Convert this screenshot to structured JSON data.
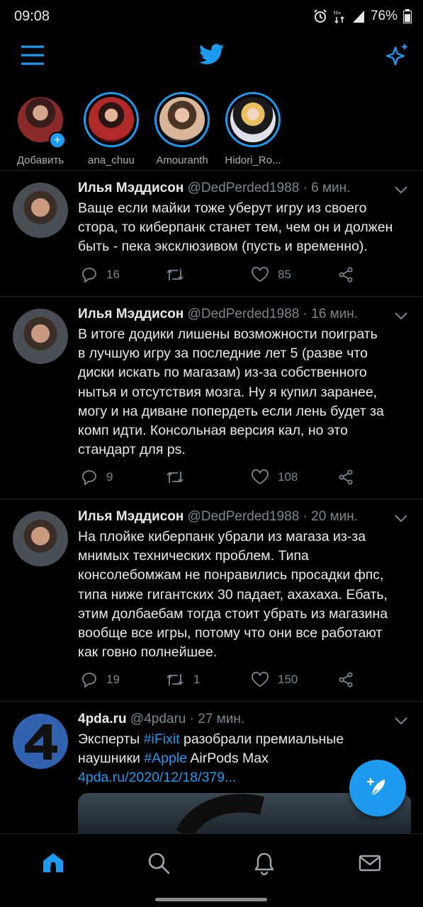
{
  "status": {
    "time": "09:08",
    "battery": "76%"
  },
  "fleets": [
    {
      "name": "Добавить",
      "color": "#8a3a3a"
    },
    {
      "name": "ana_chuu",
      "color": "#a02828"
    },
    {
      "name": "Amouranth",
      "color": "#6a5a4a"
    },
    {
      "name": "Hidori_Ro...",
      "color": "#c8c0b8"
    }
  ],
  "tweets": [
    {
      "name": "Илья Мэддисон",
      "handle": "@DedPerded1988",
      "time": "· 6 мин.",
      "lines": [
        "Ваще если майки тоже уберут игру из своего",
        "стора, то киберпанк станет тем, чем он и должен",
        "быть - пека эксклюзивом (пусть и временно)."
      ],
      "replies": "16",
      "retweets": "",
      "likes": "85"
    },
    {
      "name": "Илья Мэддисон",
      "handle": "@DedPerded1988",
      "time": "· 16 мин.",
      "lines": [
        "В итоге додики лишены возможности поиграть",
        "в лучшую игру за последние лет 5 (разве что",
        "диски искать по магазам) из-за собственного",
        "нытья и отсутствия мозга. Ну я купил заранее,",
        "могу и на диване попердеть если лень будет за",
        "комп идти. Консольная версия кал, но это",
        "стандарт для ps."
      ],
      "replies": "9",
      "retweets": "",
      "likes": "108"
    },
    {
      "name": "Илья Мэддисон",
      "handle": "@DedPerded1988",
      "time": "· 20 мин.",
      "lines": [
        "На плойке киберпанк убрали из магаза из-за",
        "мнимых технических проблем. Типа",
        "консолебомжам не понравились просадки фпс,",
        "типа ниже гигантских 30 падает, ахахаха. Ебать,",
        "этим долбаебам тогда стоит убрать из магазина",
        "вообще все игры, потому что они все работают",
        "как говно полнейшее."
      ],
      "replies": "19",
      "retweets": "1",
      "likes": "150"
    }
  ],
  "tweet4": {
    "name": "4pda.ru",
    "handle": "@4pdaru",
    "time": "· 27 мин.",
    "p1": "Эксперты ",
    "tag1": "#iFixit",
    "p2": " разобрали премиальные",
    "p3": "наушники ",
    "tag2": "#Apple",
    "p4": " AirPods Max",
    "link": "4pda.ru/2020/12/18/379..."
  },
  "accent": "#1d9bf0"
}
